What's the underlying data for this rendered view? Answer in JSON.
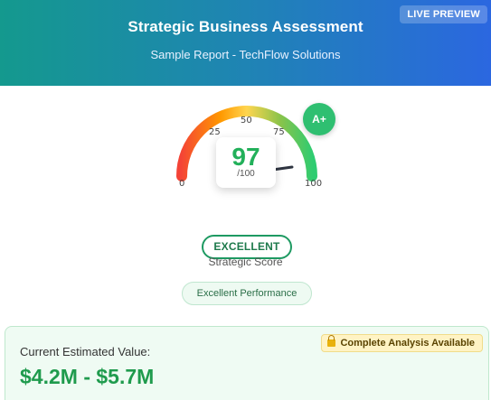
{
  "header": {
    "title": "Strategic Business Assessment",
    "subtitle": "Sample Report - TechFlow Solutions",
    "badge": "LIVE PREVIEW"
  },
  "gauge": {
    "score": 97,
    "max_label": "/100",
    "tick_labels": [
      "0",
      "25",
      "50",
      "75",
      "100"
    ],
    "grade": "A+",
    "colors": [
      "#f44336",
      "#ff9800",
      "#ffd54f",
      "#8bc34a",
      "#2ecc71"
    ]
  },
  "rating": {
    "label": "EXCELLENT",
    "caption": "Strategic Score",
    "performance": "Excellent Performance"
  },
  "valuation": {
    "label": "Current Estimated Value:",
    "range": "$4.2M - $5.7M",
    "badge": "Complete Analysis Available",
    "badge_icon": "lock-icon"
  }
}
